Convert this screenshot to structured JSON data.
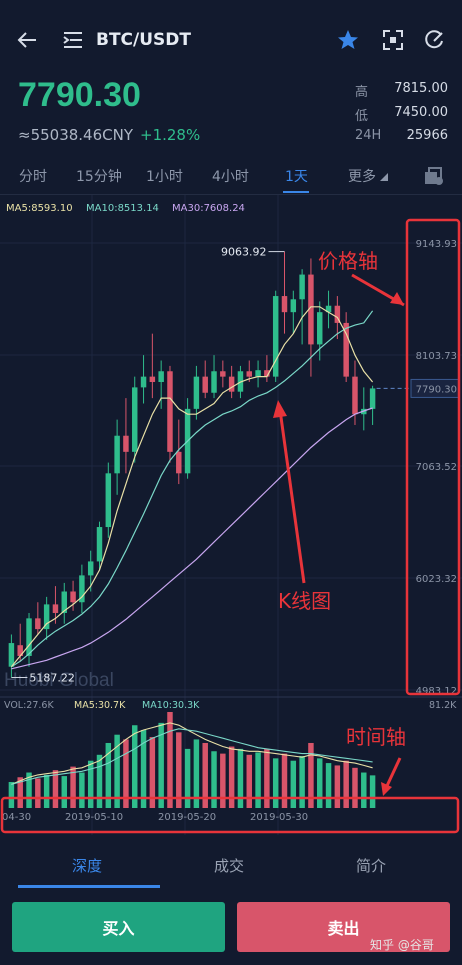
{
  "header": {
    "title": "BTC/USDT",
    "icons": [
      "back-arrow-icon",
      "menu-list-icon",
      "star-icon",
      "fullscreen-icon",
      "refresh-icon"
    ],
    "accent_color": "#3a86e8"
  },
  "ticker": {
    "last_price": "7790.30",
    "cny_price": "≈55038.46CNY",
    "change_pct": "+1.28%",
    "stats": [
      {
        "label": "高",
        "value": "7815.00"
      },
      {
        "label": "低",
        "value": "7450.00"
      },
      {
        "label": "24H",
        "value": "25966"
      }
    ],
    "up_color": "#2fbd8c",
    "down_color": "#d8556a"
  },
  "tabs": [
    {
      "label": "分时"
    },
    {
      "label": "15分钟"
    },
    {
      "label": "1小时"
    },
    {
      "label": "4小时"
    },
    {
      "label": "1天"
    },
    {
      "label": "更多"
    }
  ],
  "active_tab": "1天",
  "ma_legend": [
    {
      "label": "MA5:8593.10",
      "color": "#e8e0a6"
    },
    {
      "label": "MA10:8513.14",
      "color": "#7ad8c8"
    },
    {
      "label": "MA30:7608.24",
      "color": "#c8a6f0"
    }
  ],
  "price_axis": {
    "ticks": [
      "9143.93",
      "8103.73",
      "7063.52",
      "6023.32",
      "4983.12"
    ],
    "current": "7790.30"
  },
  "markers": {
    "high": "9063.92",
    "low": "5187.22"
  },
  "brand_watermark": "Huobi Global",
  "volume_legend": {
    "vol": "VOL:27.6K",
    "ma5": "MA5:30.7K",
    "ma10": "MA10:30.3K",
    "max": "81.2K"
  },
  "time_axis": {
    "ticks": [
      "04-30",
      "2019-05-10",
      "2019-05-20",
      "2019-05-30"
    ]
  },
  "annotations": {
    "price_axis": "价格轴",
    "kline": "K线图",
    "time_axis": "时间轴",
    "color": "#e8343a"
  },
  "bottom_tabs": [
    {
      "label": "深度"
    },
    {
      "label": "成交"
    },
    {
      "label": "简介"
    }
  ],
  "actions": {
    "buy": "买入",
    "sell": "卖出"
  },
  "watermark": "知乎 @谷哥",
  "chart_data": {
    "type": "candlestick",
    "ylim": [
      4983.12,
      9143.93
    ],
    "candles": [
      {
        "o": 5200,
        "h": 5500,
        "l": 5100,
        "c": 5420
      },
      {
        "o": 5400,
        "h": 5600,
        "l": 5250,
        "c": 5300
      },
      {
        "o": 5300,
        "h": 5700,
        "l": 5200,
        "c": 5650
      },
      {
        "o": 5650,
        "h": 5800,
        "l": 5500,
        "c": 5550
      },
      {
        "o": 5550,
        "h": 5850,
        "l": 5450,
        "c": 5780
      },
      {
        "o": 5780,
        "h": 5950,
        "l": 5600,
        "c": 5700
      },
      {
        "o": 5700,
        "h": 5980,
        "l": 5600,
        "c": 5900
      },
      {
        "o": 5900,
        "h": 6000,
        "l": 5720,
        "c": 5800
      },
      {
        "o": 5800,
        "h": 6150,
        "l": 5700,
        "c": 6050
      },
      {
        "o": 6050,
        "h": 6280,
        "l": 5900,
        "c": 6180
      },
      {
        "o": 6180,
        "h": 6550,
        "l": 6100,
        "c": 6500
      },
      {
        "o": 6500,
        "h": 7100,
        "l": 6400,
        "c": 7000
      },
      {
        "o": 7000,
        "h": 7500,
        "l": 6800,
        "c": 7350
      },
      {
        "o": 7350,
        "h": 7700,
        "l": 7000,
        "c": 7200
      },
      {
        "o": 7200,
        "h": 7900,
        "l": 7100,
        "c": 7800
      },
      {
        "o": 7800,
        "h": 8100,
        "l": 7650,
        "c": 7900
      },
      {
        "o": 7900,
        "h": 8300,
        "l": 7700,
        "c": 7850
      },
      {
        "o": 7850,
        "h": 8050,
        "l": 7600,
        "c": 7950
      },
      {
        "o": 7950,
        "h": 8000,
        "l": 7100,
        "c": 7200
      },
      {
        "o": 7200,
        "h": 7500,
        "l": 6900,
        "c": 7000
      },
      {
        "o": 7000,
        "h": 7700,
        "l": 6950,
        "c": 7600
      },
      {
        "o": 7600,
        "h": 8000,
        "l": 7500,
        "c": 7900
      },
      {
        "o": 7900,
        "h": 8050,
        "l": 7700,
        "c": 7750
      },
      {
        "o": 7750,
        "h": 8100,
        "l": 7700,
        "c": 7950
      },
      {
        "o": 7950,
        "h": 8050,
        "l": 7800,
        "c": 7900
      },
      {
        "o": 7900,
        "h": 8000,
        "l": 7700,
        "c": 7760
      },
      {
        "o": 7760,
        "h": 8000,
        "l": 7700,
        "c": 7950
      },
      {
        "o": 7950,
        "h": 8050,
        "l": 7850,
        "c": 7900
      },
      {
        "o": 7900,
        "h": 8050,
        "l": 7800,
        "c": 7960
      },
      {
        "o": 7960,
        "h": 8100,
        "l": 7850,
        "c": 7900
      },
      {
        "o": 7900,
        "h": 8700,
        "l": 7850,
        "c": 8650
      },
      {
        "o": 8650,
        "h": 9063.92,
        "l": 8300,
        "c": 8500
      },
      {
        "o": 8500,
        "h": 8700,
        "l": 8300,
        "c": 8620
      },
      {
        "o": 8620,
        "h": 8900,
        "l": 8200,
        "c": 8850
      },
      {
        "o": 8850,
        "h": 9000,
        "l": 7900,
        "c": 8200
      },
      {
        "o": 8200,
        "h": 8600,
        "l": 8050,
        "c": 8500
      },
      {
        "o": 8500,
        "h": 8700,
        "l": 8350,
        "c": 8560
      },
      {
        "o": 8560,
        "h": 8650,
        "l": 8250,
        "c": 8400
      },
      {
        "o": 8400,
        "h": 8500,
        "l": 7850,
        "c": 7900
      },
      {
        "o": 7900,
        "h": 8050,
        "l": 7450,
        "c": 7550
      },
      {
        "o": 7550,
        "h": 7800,
        "l": 7400,
        "c": 7600
      },
      {
        "o": 7600,
        "h": 7815,
        "l": 7450,
        "c": 7790.3
      }
    ],
    "ma5": [
      5200,
      5300,
      5400,
      5500,
      5600,
      5650,
      5720,
      5780,
      5850,
      5950,
      6100,
      6350,
      6650,
      6900,
      7150,
      7350,
      7550,
      7700,
      7700,
      7600,
      7550,
      7550,
      7600,
      7650,
      7750,
      7800,
      7850,
      7880,
      7900,
      7900,
      8050,
      8200,
      8300,
      8450,
      8550,
      8550,
      8500,
      8450,
      8300,
      8100,
      7950,
      7850
    ],
    "ma10": [
      5200,
      5250,
      5320,
      5400,
      5470,
      5530,
      5580,
      5630,
      5690,
      5760,
      5850,
      5970,
      6120,
      6280,
      6450,
      6620,
      6800,
      6980,
      7120,
      7220,
      7300,
      7380,
      7450,
      7500,
      7550,
      7580,
      7620,
      7680,
      7720,
      7750,
      7800,
      7860,
      7930,
      8000,
      8080,
      8160,
      8230,
      8300,
      8350,
      8380,
      8400,
      8513.14
    ],
    "ma30": [
      5180,
      5200,
      5220,
      5240,
      5260,
      5290,
      5320,
      5350,
      5380,
      5420,
      5470,
      5520,
      5580,
      5640,
      5710,
      5780,
      5850,
      5920,
      5990,
      6060,
      6130,
      6200,
      6280,
      6360,
      6440,
      6520,
      6600,
      6680,
      6760,
      6840,
      6920,
      7000,
      7080,
      7160,
      7240,
      7310,
      7380,
      7440,
      7500,
      7550,
      7580,
      7608.24
    ],
    "volume": [
      22,
      26,
      30,
      25,
      28,
      32,
      27,
      35,
      30,
      40,
      45,
      55,
      62,
      58,
      70,
      66,
      60,
      72,
      81.2,
      64,
      50,
      58,
      55,
      48,
      46,
      52,
      50,
      45,
      47,
      50,
      42,
      46,
      40,
      44,
      55,
      42,
      38,
      36,
      40,
      34,
      30,
      27.6
    ],
    "vol_ma5": [
      20,
      23,
      26,
      28,
      29,
      30,
      31,
      33,
      34,
      37,
      40,
      46,
      52,
      58,
      63,
      66,
      68,
      70,
      72,
      70,
      66,
      62,
      58,
      55,
      52,
      50,
      49,
      48,
      48,
      47,
      46,
      45,
      44,
      43,
      45,
      44,
      42,
      40,
      39,
      38,
      36,
      34
    ],
    "vol_ma10": [
      20,
      22,
      24,
      26,
      27,
      28,
      29,
      30,
      31,
      33,
      35,
      38,
      42,
      46,
      50,
      55,
      59,
      62,
      65,
      67,
      66,
      65,
      63,
      61,
      59,
      57,
      55,
      53,
      51,
      50,
      49,
      48,
      47,
      46,
      46,
      45,
      44,
      43,
      42,
      41,
      40,
      39
    ]
  }
}
